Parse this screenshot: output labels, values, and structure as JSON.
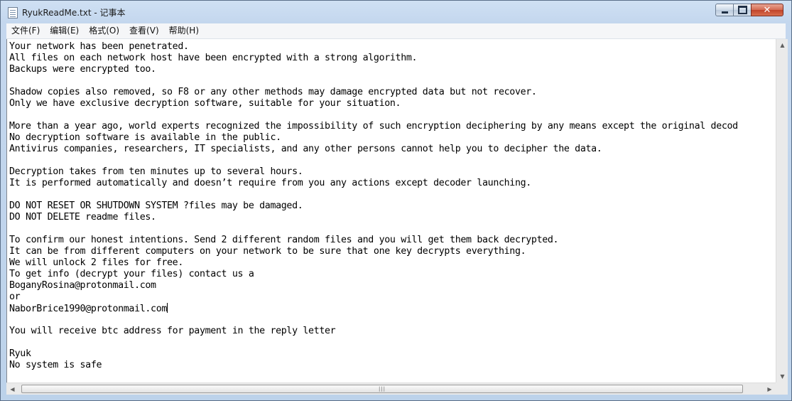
{
  "window": {
    "title": "RyukReadMe.txt - 记事本",
    "controls": {
      "minimize": "minimize",
      "maximize": "maximize",
      "close": "✕"
    }
  },
  "menubar": {
    "items": [
      "文件(F)",
      "编辑(E)",
      "格式(O)",
      "查看(V)",
      "帮助(H)"
    ]
  },
  "document": {
    "lines": [
      "Your network has been penetrated.",
      "All files on each network host have been encrypted with a strong algorithm.",
      "Backups were encrypted too.",
      "",
      "Shadow copies also removed, so F8 or any other methods may damage encrypted data but not recover.",
      "Only we have exclusive decryption software, suitable for your situation.",
      "",
      "More than a year ago, world experts recognized the impossibility of such encryption deciphering by any means except the original decod",
      "No decryption software is available in the public.",
      "Antivirus companies, researchers, IT specialists, and any other persons cannot help you to decipher the data.",
      "",
      "Decryption takes from ten minutes up to several hours.",
      "It is performed automatically and doesn’t require from you any actions except decoder launching.",
      "",
      "DO NOT RESET OR SHUTDOWN SYSTEM ?files may be damaged.",
      "DO NOT DELETE readme files.",
      "",
      "To confirm our honest intentions. Send 2 different random files and you will get them back decrypted.",
      "It can be from different computers on your network to be sure that one key decrypts everything.",
      "We will unlock 2 files for free.",
      "To get info (decrypt your files) contact us a",
      "BoganyRosina@protonmail.com",
      "or",
      "NaborBrice1990@protonmail.com",
      "",
      "You will receive btc address for payment in the reply letter",
      "",
      "Ryuk",
      "No system is safe"
    ],
    "caret_line": 23
  },
  "scrollbars": {
    "vertical": {
      "up_icon": "▲",
      "down_icon": "▼"
    },
    "horizontal": {
      "left_icon": "◀",
      "right_icon": "▶",
      "grip": "|||"
    }
  }
}
